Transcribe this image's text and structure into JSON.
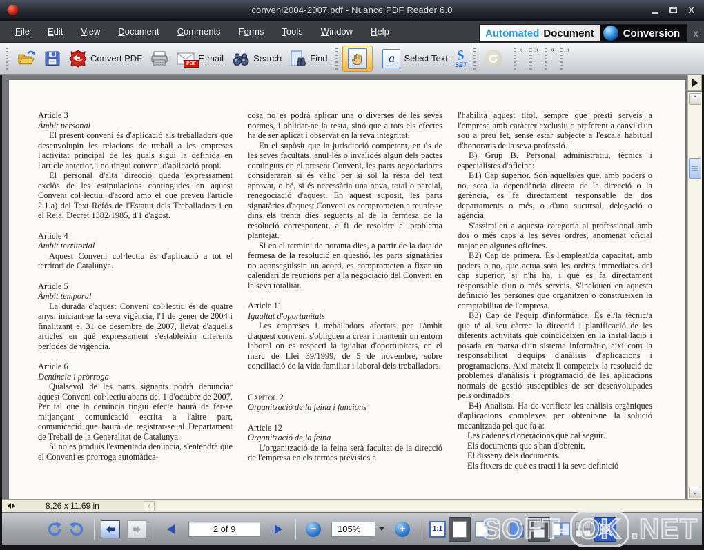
{
  "window": {
    "title": "conveni2004-2007.pdf - Nuance PDF Reader 6.0",
    "close_glyph": "X"
  },
  "menu": {
    "items": [
      {
        "id": "file",
        "label": "File",
        "u": 0
      },
      {
        "id": "edit",
        "label": "Edit",
        "u": 0
      },
      {
        "id": "view",
        "label": "View",
        "u": 0
      },
      {
        "id": "document",
        "label": "Document",
        "u": 0
      },
      {
        "id": "comments",
        "label": "Comments",
        "u": 0
      },
      {
        "id": "forms",
        "label": "Forms",
        "u": 1
      },
      {
        "id": "tools",
        "label": "Tools",
        "u": 0
      },
      {
        "id": "window",
        "label": "Window",
        "u": 0
      },
      {
        "id": "help",
        "label": "Help",
        "u": 0
      }
    ]
  },
  "brand": {
    "automated": "Automated",
    "document": "Document",
    "conversion": "Conversion",
    "close": "x"
  },
  "toolbar": {
    "convert_pdf": "Convert PDF",
    "email": "E-mail",
    "pdf_badge": "PDF",
    "search": "Search",
    "find": "Find",
    "select_glyph": "a",
    "select_text": "Select Text",
    "set_s": "S",
    "set_label": "SET",
    "overflow_glyph": "»"
  },
  "document": {
    "columns": [
      {
        "blocks": [
          {
            "s": "h",
            "t": "Article 3"
          },
          {
            "s": "i",
            "t": "Àmbit personal"
          },
          {
            "s": "p",
            "t": "El present conveni és d'aplicació als treballadors que desenvolupin les relacions de treball a les empreses l'activitat principal de les quals sigui la definida en l'article anterior, i no tingui conveni d'aplicació propi."
          },
          {
            "s": "p",
            "t": "El personal d'alta direcció queda expressament exclòs de les estipulacions contingudes en aquest Conveni col·lectiu, d'acord amb el que preveu l'article 2.1.a) del Text Refós de l'Estatut dels Treballadors i en el Reial Decret 1382/1985, d'1 d'agost."
          },
          {
            "s": "h",
            "t": "Article 4"
          },
          {
            "s": "i",
            "t": "Àmbit territorial"
          },
          {
            "s": "p",
            "t": "Aquest Conveni col·lectiu és d'aplicació a tot el territori de Catalunya."
          },
          {
            "s": "h",
            "t": "Article 5"
          },
          {
            "s": "i",
            "t": "Àmbit temporal"
          },
          {
            "s": "p",
            "t": "La durada d'aquest Conveni col·lectiu és de quatre anys, iniciant-se la seva vigència, l'1 de gener de 2004 i finalitzant el 31 de desembre de 2007, llevat d'aquells articles en què expressament s'estableixin diferents períodes de vigència."
          },
          {
            "s": "h",
            "t": "Article 6"
          },
          {
            "s": "i",
            "t": "Denúncia i pròrroga"
          },
          {
            "s": "p",
            "t": "Qualsevol de les parts signants podrà denunciar aquest Conveni col·lectiu abans del 1 d'octubre de 2007. Per tal que la denúncia tingui efecte haurà de fer-se mitjançant comunicació escrita a l'altre part, comunicació que haurà de registrar-se al Departament de Treball de la Generalitat de Catalunya."
          },
          {
            "s": "p",
            "t": "Si no es produís l'esmentada denúncia, s'entendrà que el Conveni es prorroga automàtica-"
          }
        ]
      },
      {
        "blocks": [
          {
            "s": "pn",
            "t": "cosa no es podrà aplicar una o diverses de les seves normes, i oblidar-ne la resta, sinó que a tots els efectes ha de ser aplicat i observat en la seva integritat."
          },
          {
            "s": "p",
            "t": "En el supòsit que la jurisdicció competent, en ús de les seves facultats, anul·lés o invalidés algun dels pactes continguts en el present Conveni, les parts negociadores consideraran si és vàlid per si sol la resta del text aprovat, o bé, si és necessària una nova, total o parcial, renegociació d'aquest. En aquest supòsit, les parts signatàries d'aquest Conveni es comprometen a reunir-se dins els trenta dies següents al de la fermesa de la resolució corresponent, a fi de resoldre el problema plantejat."
          },
          {
            "s": "p",
            "t": "Si en el termini de noranta dies, a partir de la data de fermesa de la resolució en qüestió, les parts signatàries no aconseguissin un acord, es comprometen a fixar un calendari de reunions per a la negociació del Conveni en la seva totalitat."
          },
          {
            "s": "h",
            "t": "Article 11"
          },
          {
            "s": "i",
            "t": "Igualtat d'oportunitats"
          },
          {
            "s": "p",
            "t": "Les empreses i treballadors afectats per l'àmbit d'aquest conveni, s'obliguen a crear i mantenir un entorn laboral on es respecti la igualtat d'oportunitats, en el marc de Llei 39/1999, de 5 de novembre, sobre conciliació de la vida familiar i laboral dels treballadors."
          },
          {
            "s": "cap",
            "t": "Capítol 2"
          },
          {
            "s": "i",
            "t": "Organització de la feina i funcions"
          },
          {
            "s": "h",
            "t": "Article 12"
          },
          {
            "s": "i",
            "t": "Organització de la feina"
          },
          {
            "s": "p",
            "t": "L'organització de la feina serà facultat de la direcció de l'empresa en els termes previstos a"
          }
        ]
      },
      {
        "blocks": [
          {
            "s": "pn",
            "t": "l'habilita aquest títol, sempre que presti serveis a l'empresa amb caràcter exclusiu o preferent a canvi d'un sou a preu fet, sense estar subjecte a l'escala habitual d'honoraris de la seva professió."
          },
          {
            "s": "p",
            "t": "B) Grup B. Personal administratiu, tècnics i especialistes d'oficina:"
          },
          {
            "s": "p",
            "t": "B1) Cap superior. Són aquells/es que, amb poders o no, sota la dependència directa de la direcció o la gerència, es fa directament responsable de dos departaments o més, o d'una sucursal, delegació o agència."
          },
          {
            "s": "p",
            "t": "S'assimilen a aquesta categoria al professional amb dos o més caps a les seves ordres, anomenat oficial major en algunes oficines."
          },
          {
            "s": "p",
            "t": "B2) Cap de primera. És l'empleat/da capacitat, amb poders o no, que actua sota les ordres immediates del cap superior, si n'hi ha, i que es fa directament responsable d'un o més serveis. S'inclouen en aquesta definició les persones que organitzen o construeixen la comptabilitat de l'empresa."
          },
          {
            "s": "p",
            "t": "B3) Cap de l'equip d'informàtica. És el/la tècnic/a que té al seu càrrec la direcció i planificació de les diferents activitats que coincideixen en la instal·lació i posada en marxa d'un sistema informàtic, així com la responsabilitat d'equips d'anàlisis d'aplicacions i programacions. Així mateix li competeix la resolució de problemes d'anàlisis i programació de les aplicacions normals de gestió susceptibles de ser desenvolupades pels ordinadors."
          },
          {
            "s": "p",
            "t": "B4) Analista. Ha de verificar les anàlisis orgàniques d'aplicacions complexes per obtenir-ne la solució mecanitzada pel que fa a:"
          },
          {
            "s": "li",
            "t": "Les cadenes d'operacions que cal seguir."
          },
          {
            "s": "li",
            "t": "Els documents que s'han d'obtenir."
          },
          {
            "s": "li",
            "t": "El disseny dels documents."
          },
          {
            "s": "li",
            "t": "Els fitxers de què es tracti i la seva definició"
          }
        ]
      }
    ]
  },
  "statusbar": {
    "page_size": "8.26 x 11.69 in"
  },
  "bottom": {
    "page_indicator": "2 of 9",
    "zoom_level": "105%",
    "actual_size": "1:1"
  },
  "watermark": {
    "left": "SOFT-",
    "boxed": "OK",
    "right": ".NET"
  },
  "colors": {
    "accent_blue": "#2d9fd8",
    "selection_orange": "#f9cf72",
    "convert_red": "#c9231a",
    "paper": "#fcfbf7"
  }
}
